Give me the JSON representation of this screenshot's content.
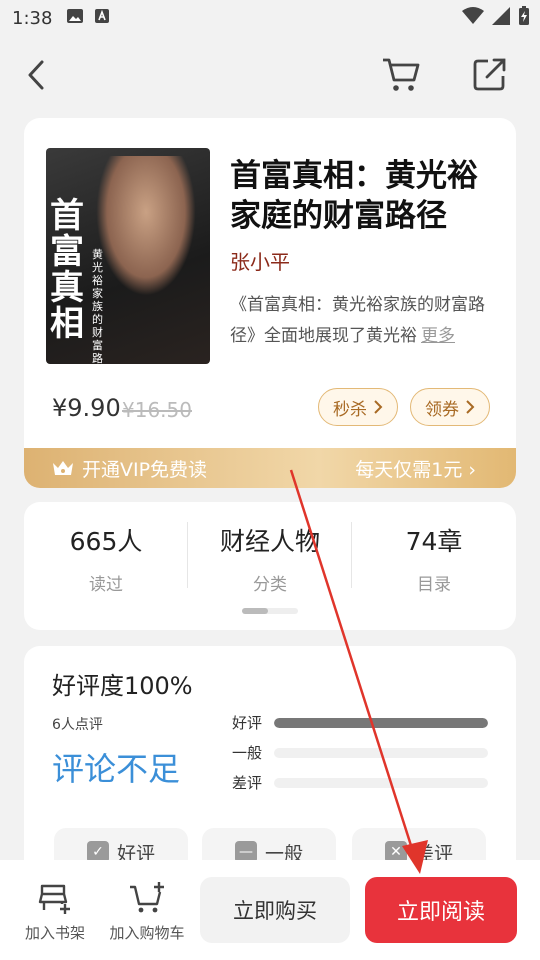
{
  "status_bar": {
    "time": "1:38"
  },
  "book": {
    "title": "首富真相：黄光裕家庭的财富路径",
    "author": "张小平",
    "description": "《首富真相：黄光裕家族的财富路径》全面地展现了黄光裕",
    "more_label": "更多",
    "cover_title": "首富真相",
    "cover_subtitle": "黄光裕家族的财富路径",
    "price": "¥9.90",
    "original_price": "¥16.50",
    "flash_sale_label": "秒杀",
    "coupon_label": "领券"
  },
  "vip": {
    "left_label": "开通VIP免费读",
    "right_label": "每天仅需1元"
  },
  "stats": [
    {
      "value": "665人",
      "label": "读过"
    },
    {
      "value": "财经人物",
      "label": "分类"
    },
    {
      "value": "74章",
      "label": "目录"
    }
  ],
  "reviews": {
    "title": "好评度100%",
    "count_text": "6人点评",
    "insufficient_text": "评论不足",
    "bars": [
      {
        "label": "好评",
        "fraction": 1.0
      },
      {
        "label": "一般",
        "fraction": 0.0
      },
      {
        "label": "差评",
        "fraction": 0.0
      }
    ],
    "rate_buttons": [
      "好评",
      "一般",
      "差评"
    ]
  },
  "bottom": {
    "shelf_label": "加入书架",
    "cart_label": "加入购物车",
    "buy_label": "立即购买",
    "read_label": "立即阅读"
  },
  "colors": {
    "accent": "#e8333c",
    "vip_gold": "#ddb272",
    "author": "#8b2a1a",
    "insufficient": "#3b8fd8"
  }
}
